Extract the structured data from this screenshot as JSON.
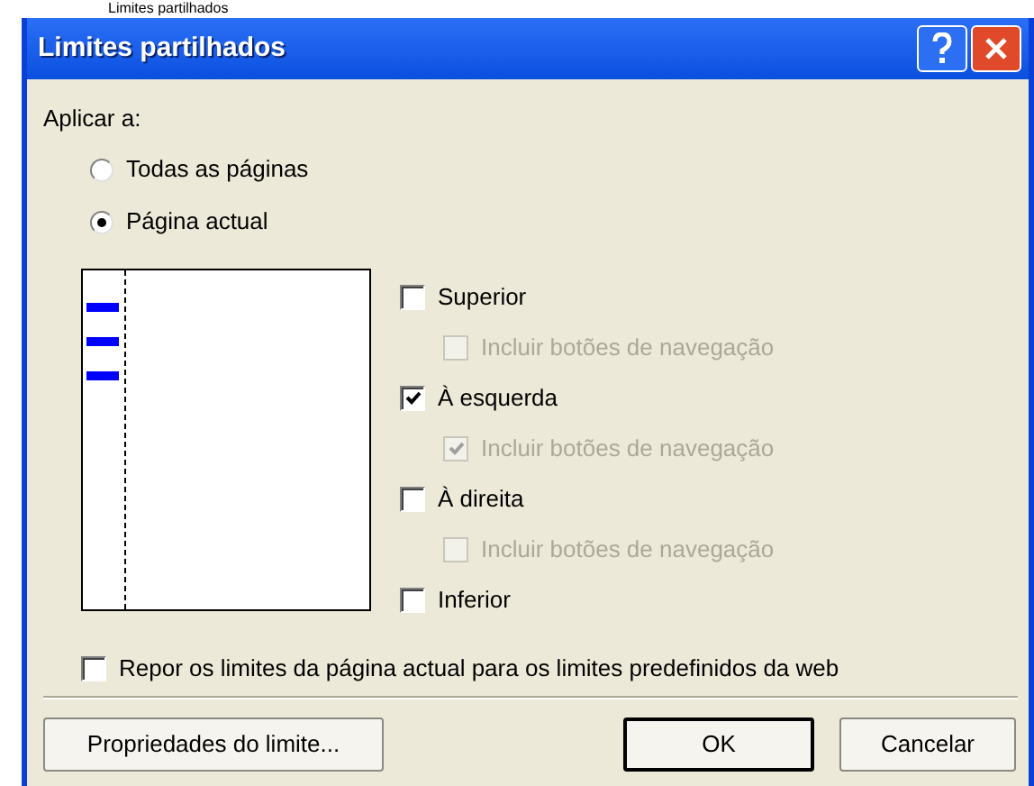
{
  "caption": "Limites partilhados",
  "window": {
    "title": "Limites partilhados"
  },
  "apply_label": "Aplicar a:",
  "radios": [
    {
      "label": "Todas as páginas",
      "selected": false
    },
    {
      "label": "Página actual",
      "selected": true
    }
  ],
  "borders": [
    {
      "label": "Superior",
      "checked": false,
      "children": [
        {
          "label": "Incluir botões de navegação",
          "checked": false,
          "disabled": true
        }
      ]
    },
    {
      "label": "À esquerda",
      "checked": true,
      "children": [
        {
          "label": "Incluir botões de navegação",
          "checked": true,
          "disabled": true
        }
      ]
    },
    {
      "label": "À direita",
      "checked": false,
      "children": [
        {
          "label": "Incluir botões de navegação",
          "checked": false,
          "disabled": true
        }
      ]
    },
    {
      "label": "Inferior",
      "checked": false
    }
  ],
  "reset": {
    "label": "Repor os limites da página actual para os limites predefinidos da web",
    "checked": false
  },
  "buttons": [
    {
      "label": "Propriedades do limite...",
      "default": false
    },
    {
      "label": "OK",
      "default": true
    },
    {
      "label": "Cancelar",
      "default": false
    }
  ]
}
